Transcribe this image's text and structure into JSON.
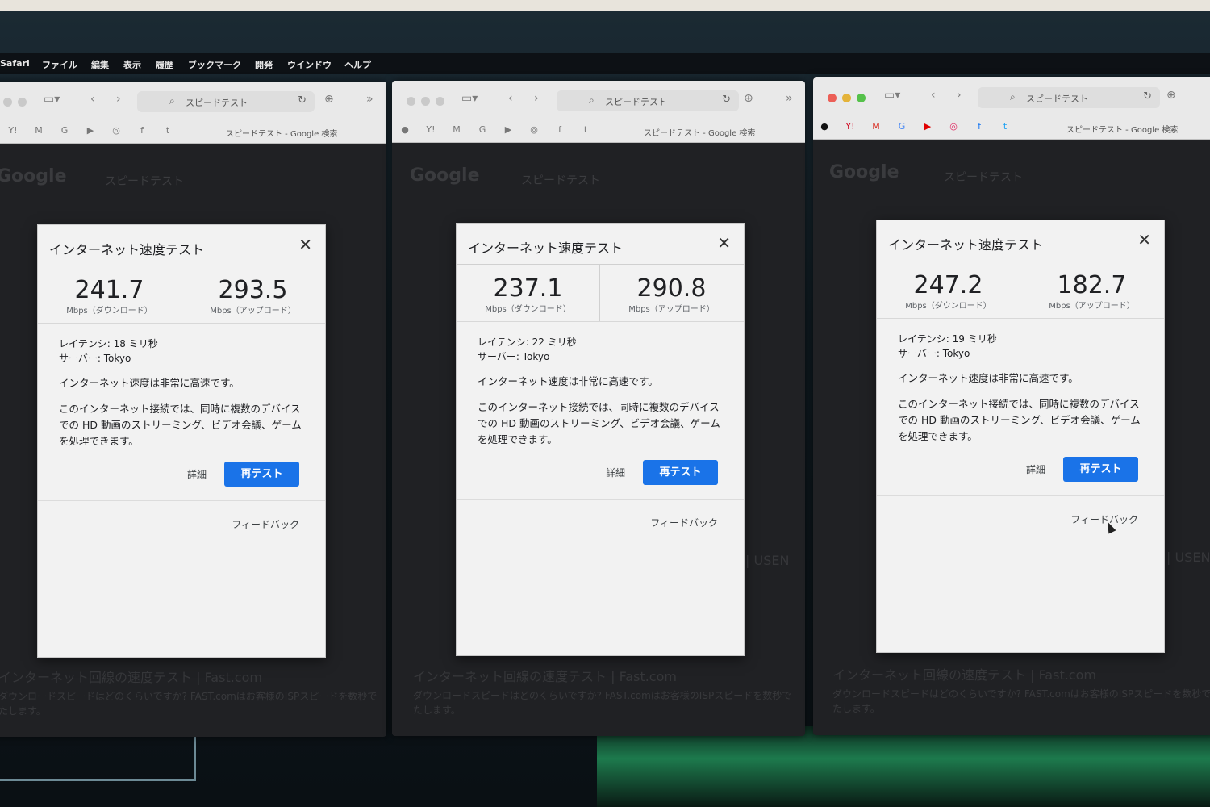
{
  "menubar": [
    "Safari",
    "ファイル",
    "編集",
    "表示",
    "履歴",
    "ブックマーク",
    "開発",
    "ウインドウ",
    "ヘルプ"
  ],
  "browser": {
    "address": "スピードテスト",
    "bookmark_search": "スピードテスト - Google 検索",
    "bookmark_icons": [
      "Y!",
      "M",
      "G",
      "▶",
      "◎",
      "f",
      "t"
    ]
  },
  "google_bg": {
    "logo": "Google",
    "query": "スピードテスト",
    "result_title": "インターネット回線の速度テスト | Fast.com",
    "result_text1": "ダウンロードスピードはどのくらいですか? FAST.comはお客様のISPスピードを数秒で",
    "result_text2": "たします。",
    "usen": "| USEN"
  },
  "dialogs": [
    {
      "title": "インターネット速度テスト",
      "download": "241.7",
      "download_label": "Mbps（ダウンロード）",
      "upload": "293.5",
      "upload_label": "Mbps（アップロード）",
      "latency": "レイテンシ: 18 ミリ秒",
      "server": "サーバー: Tokyo",
      "summary": "インターネット速度は非常に高速です。",
      "detail_text": "このインターネット接続では、同時に複数のデバイスでの HD 動画のストリーミング、ビデオ会議、ゲームを処理できます。",
      "detail_button": "詳細",
      "retest_button": "再テスト",
      "feedback": "フィードバック"
    },
    {
      "title": "インターネット速度テスト",
      "download": "237.1",
      "download_label": "Mbps（ダウンロード）",
      "upload": "290.8",
      "upload_label": "Mbps（アップロード）",
      "latency": "レイテンシ: 22 ミリ秒",
      "server": "サーバー: Tokyo",
      "summary": "インターネット速度は非常に高速です。",
      "detail_text": "このインターネット接続では、同時に複数のデバイスでの HD 動画のストリーミング、ビデオ会議、ゲームを処理できます。",
      "detail_button": "詳細",
      "retest_button": "再テスト",
      "feedback": "フィードバック"
    },
    {
      "title": "インターネット速度テスト",
      "download": "247.2",
      "download_label": "Mbps（ダウンロード）",
      "upload": "182.7",
      "upload_label": "Mbps（アップロード）",
      "latency": "レイテンシ: 19 ミリ秒",
      "server": "サーバー: Tokyo",
      "summary": "インターネット速度は非常に高速です。",
      "detail_text": "このインターネット接続では、同時に複数のデバイスでの HD 動画のストリーミング、ビデオ会議、ゲームを処理できます。",
      "detail_button": "詳細",
      "retest_button": "再テスト",
      "feedback": "フィードバック"
    }
  ]
}
